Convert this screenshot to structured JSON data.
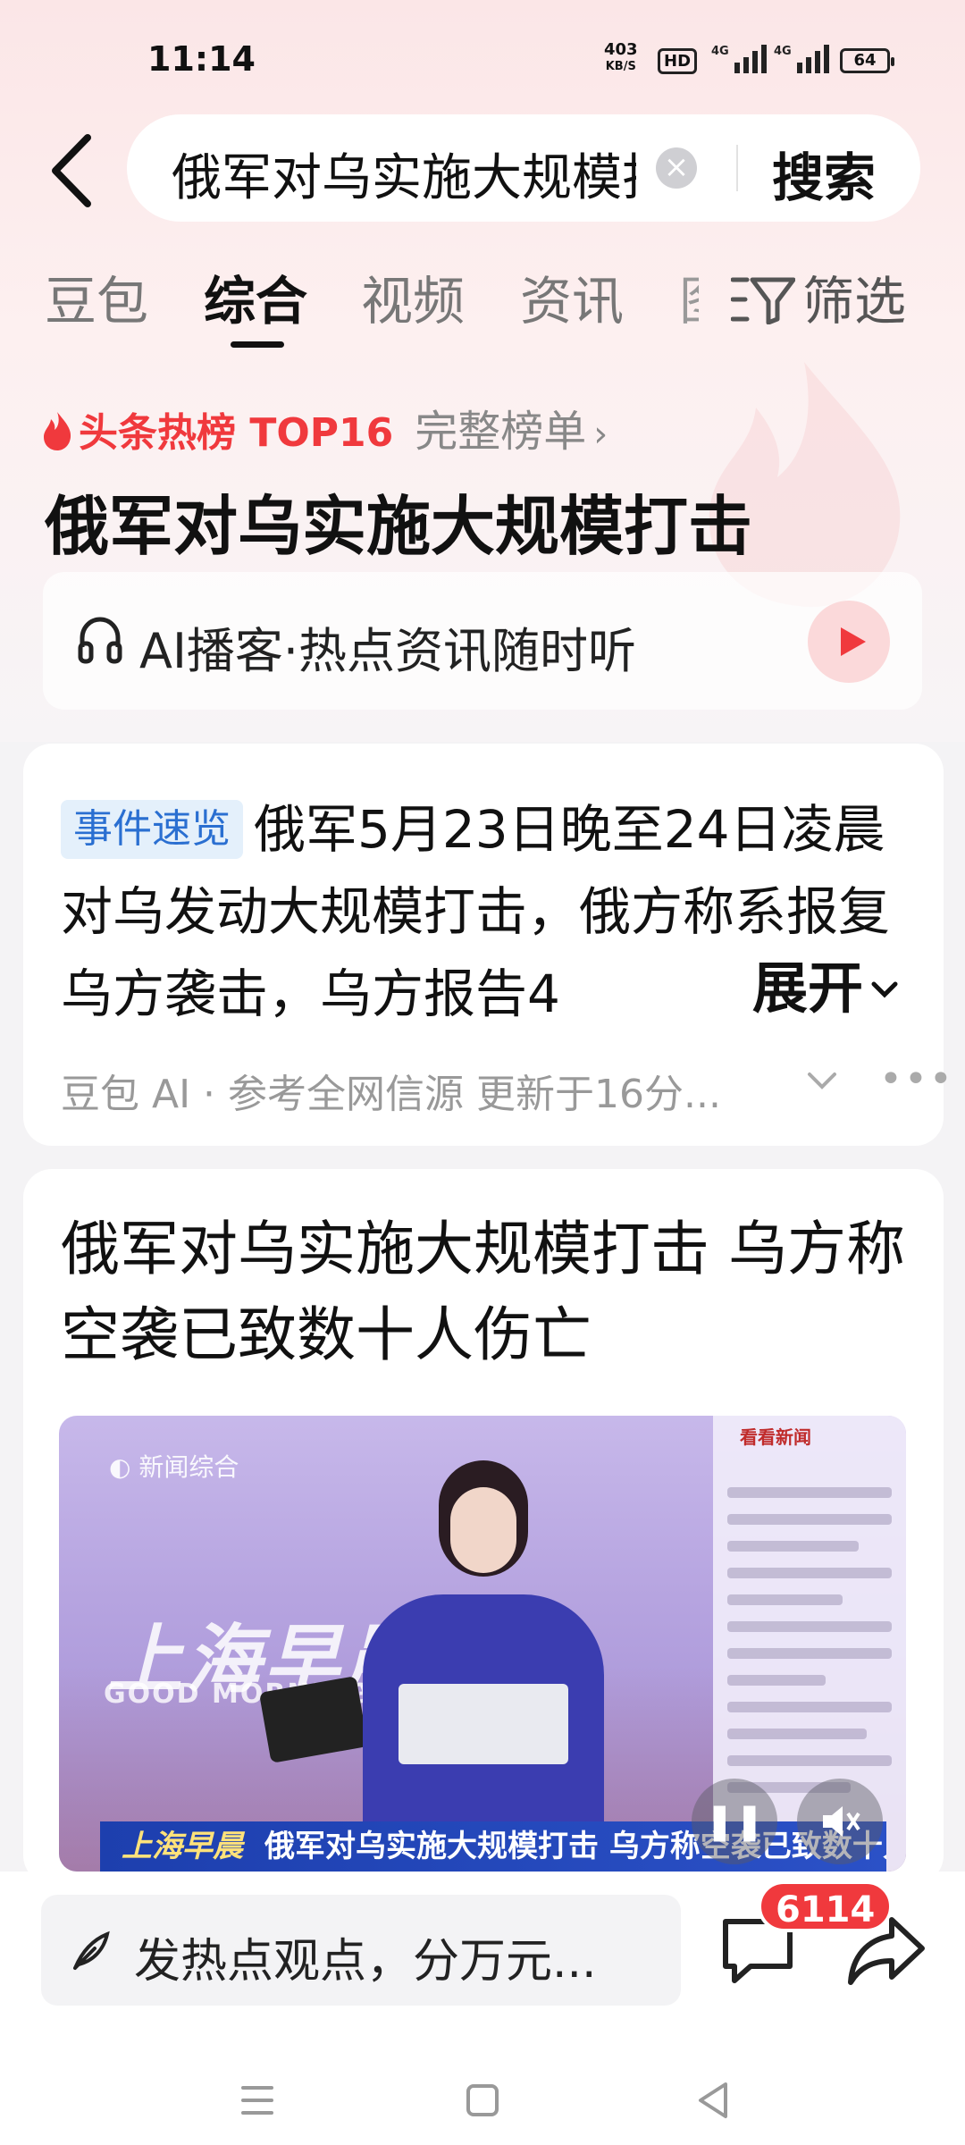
{
  "status_bar": {
    "time": "11:14",
    "net_speed_value": "403",
    "net_speed_unit": "KB/S",
    "hd_label": "HD",
    "signal1_label": "4G",
    "signal2_label": "4G",
    "battery": "64"
  },
  "search": {
    "query": "俄军对乌实施大规模打击",
    "button": "搜索"
  },
  "tabs": {
    "items": [
      "豆包",
      "综合",
      "视频",
      "资讯"
    ],
    "clipped": "图",
    "active_index": 1,
    "filter": "筛选"
  },
  "hot": {
    "label": "头条热榜 TOP16",
    "more": "完整榜单",
    "title": "俄军对乌实施大规模打击"
  },
  "podcast": {
    "label": "AI播客·热点资讯随时听"
  },
  "summary_card": {
    "badge": "事件速览",
    "text": "俄军5月23日晚至24日凌晨对乌发动大规模打击，俄方称系报复乌方袭击，乌方报告4",
    "expand": "展开",
    "source": "豆包 AI · 参考全网信源 更新于16分..."
  },
  "news_card": {
    "headline": "俄军对乌实施大规模打击 乌方称空袭已致数十人伤亡",
    "video": {
      "channel": "新闻综合",
      "program": "上海早晨",
      "program_en": "GOOD MORNING SHANGHAI",
      "side_title": "看看新闻",
      "ticker_brand": "上海早晨",
      "ticker": "俄军对乌实施大规模打击 乌方称空袭已致数十人伤亡"
    }
  },
  "bottom": {
    "comment_placeholder": "发热点观点，分万元...",
    "comment_count": "6114"
  },
  "colors": {
    "accent_red": "#f0393d",
    "badge_blue": "#2a6fd1",
    "ticker_blue": "#1d3fae"
  }
}
